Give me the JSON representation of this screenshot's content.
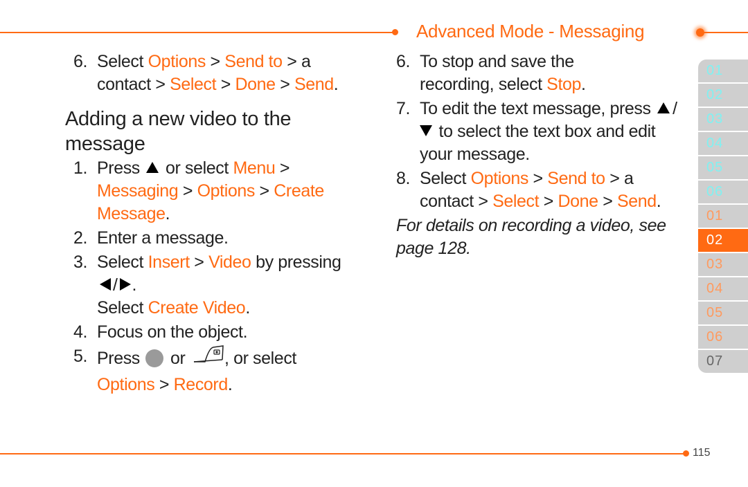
{
  "header": {
    "title": "Advanced Mode - Messaging"
  },
  "left_column": {
    "intro_step": {
      "number": "6.",
      "parts": [
        "Select ",
        "Options",
        " > ",
        "Send to",
        " > a contact > ",
        "Select",
        " > ",
        "Done",
        " > ",
        "Send",
        "."
      ]
    },
    "section_title": "Adding a new video to the message",
    "steps": [
      {
        "number": "1.",
        "text_a": "Press ",
        "icon": "up-arrow-key",
        "text_b": " or select ",
        "link1": "Menu",
        "sep1": " > ",
        "link2": "Messaging",
        "sep2": " > ",
        "link3": "Options",
        "sep3": " > ",
        "link4": "Create Message",
        "end": "."
      },
      {
        "number": "2.",
        "text": "Enter a message."
      },
      {
        "number": "3.",
        "text_a": "Select ",
        "link1": "Insert",
        "sep1": " > ",
        "link2": "Video",
        "text_b": " by pressing ",
        "icons": [
          "left-arrow-key",
          "right-arrow-key"
        ],
        "end": ".",
        "line2_a": "Select ",
        "line2_link": "Create Video",
        "line2_end": "."
      },
      {
        "number": "4.",
        "text": "Focus on the object."
      },
      {
        "number": "5.",
        "text_a": "Press ",
        "icon1": "center-key",
        "text_b": " or ",
        "icon2": "camera-key",
        "text_c": ", or select ",
        "link1": "Options",
        "sep1": " > ",
        "link2": "Record",
        "end": "."
      }
    ]
  },
  "right_column": {
    "steps": [
      {
        "number": "6.",
        "text_a": "To stop and save the recording, select ",
        "link1": "Stop",
        "end": "."
      },
      {
        "number": "7.",
        "text_a": "To edit the text message, press ",
        "icons": [
          "up-arrow-key",
          "down-arrow-key"
        ],
        "text_b": " to select the text box and edit your message."
      },
      {
        "number": "8.",
        "text_a": "Select ",
        "link1": "Options",
        "sep1": " > ",
        "link2": "Send to",
        "text_b": " > a contact > ",
        "link3": "Select",
        "sep3": " > ",
        "link4": "Done",
        "sep4": " > ",
        "link5": "Send",
        "end": "."
      }
    ],
    "note": "For details on recording a video, see page 128."
  },
  "chapter_tabs": [
    {
      "label": "01",
      "group": "section",
      "state": "cyan"
    },
    {
      "label": "02",
      "group": "section",
      "state": "cyan"
    },
    {
      "label": "03",
      "group": "section",
      "state": "cyan"
    },
    {
      "label": "04",
      "group": "section",
      "state": "cyan"
    },
    {
      "label": "05",
      "group": "section",
      "state": "cyan"
    },
    {
      "label": "06",
      "group": "section",
      "state": "cyan"
    },
    {
      "label": "01",
      "group": "chapter",
      "state": "peach"
    },
    {
      "label": "02",
      "group": "chapter",
      "state": "active"
    },
    {
      "label": "03",
      "group": "chapter",
      "state": "peach"
    },
    {
      "label": "04",
      "group": "chapter",
      "state": "peach"
    },
    {
      "label": "05",
      "group": "chapter",
      "state": "peach"
    },
    {
      "label": "06",
      "group": "chapter",
      "state": "peach"
    },
    {
      "label": "07",
      "group": "chapter",
      "state": "grey"
    }
  ],
  "footer": {
    "page_number": "115"
  },
  "colors": {
    "accent": "#ff6a13",
    "tab_bg": "#cfcfcf",
    "tab_cyan_text": "#7ff2f2",
    "tab_peach_text": "#ff9a5e"
  }
}
